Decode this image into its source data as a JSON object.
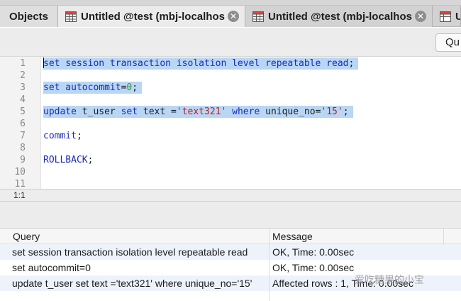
{
  "tabs": {
    "objects_label": "Objects",
    "query_tabs": [
      {
        "label": "Untitled @test (mbj-localhos…"
      },
      {
        "label": "Untitled @test (mbj-localhos…"
      },
      {
        "label": "Ur"
      }
    ]
  },
  "toolbar": {
    "query_button_label": "Qu"
  },
  "editor": {
    "line_numbers": [
      "1",
      "2",
      "3",
      "4",
      "5",
      "6",
      "7",
      "8",
      "9",
      "10",
      "11"
    ],
    "lines": [
      {
        "selected": true,
        "tokens": [
          {
            "t": "set session transaction isolation level repeatable read",
            "c": "kw"
          },
          {
            "t": ";",
            "c": "plain"
          }
        ]
      },
      {
        "selected": true,
        "tokens": []
      },
      {
        "selected": true,
        "tokens": [
          {
            "t": "set autocommit",
            "c": "kw"
          },
          {
            "t": "=",
            "c": "plain"
          },
          {
            "t": "0",
            "c": "num"
          },
          {
            "t": ";",
            "c": "plain"
          }
        ]
      },
      {
        "selected": true,
        "tokens": []
      },
      {
        "selected": true,
        "tokens": [
          {
            "t": "update",
            "c": "kw"
          },
          {
            "t": " t_user ",
            "c": "plain"
          },
          {
            "t": "set",
            "c": "kw"
          },
          {
            "t": " text =",
            "c": "plain"
          },
          {
            "t": "'text321'",
            "c": "str"
          },
          {
            "t": " ",
            "c": "plain"
          },
          {
            "t": "where",
            "c": "kw"
          },
          {
            "t": " unique_no=",
            "c": "plain"
          },
          {
            "t": "'15'",
            "c": "str"
          },
          {
            "t": ";",
            "c": "plain"
          }
        ]
      },
      {
        "selected": false,
        "tokens": []
      },
      {
        "selected": false,
        "tokens": [
          {
            "t": "commit",
            "c": "kw"
          },
          {
            "t": ";",
            "c": "plain"
          }
        ]
      },
      {
        "selected": false,
        "tokens": []
      },
      {
        "selected": false,
        "tokens": [
          {
            "t": "ROLLBACK",
            "c": "kw"
          },
          {
            "t": ";",
            "c": "plain"
          }
        ]
      },
      {
        "selected": false,
        "tokens": []
      },
      {
        "selected": false,
        "tokens": []
      }
    ]
  },
  "status": {
    "cursor_position": "1:1"
  },
  "results": {
    "columns": [
      "Query",
      "Message"
    ],
    "rows": [
      {
        "query": "set session transaction isolation level repeatable read",
        "message": "OK, Time: 0.00sec"
      },
      {
        "query": "set autocommit=0",
        "message": "OK, Time: 0.00sec"
      },
      {
        "query": "update t_user set text ='text321' where unique_no='15'",
        "message": "Affected rows : 1, Time: 0.00sec"
      }
    ]
  },
  "watermark": {
    "text": "爱吃糖果的小宝"
  },
  "colors": {
    "keyword": "#1c2bb6",
    "string": "#c01a1a",
    "number": "#2ca02c",
    "selection": "#b9d6f5"
  },
  "icons": {
    "tab_icon": "table-icon",
    "close_icon": "close-icon"
  }
}
